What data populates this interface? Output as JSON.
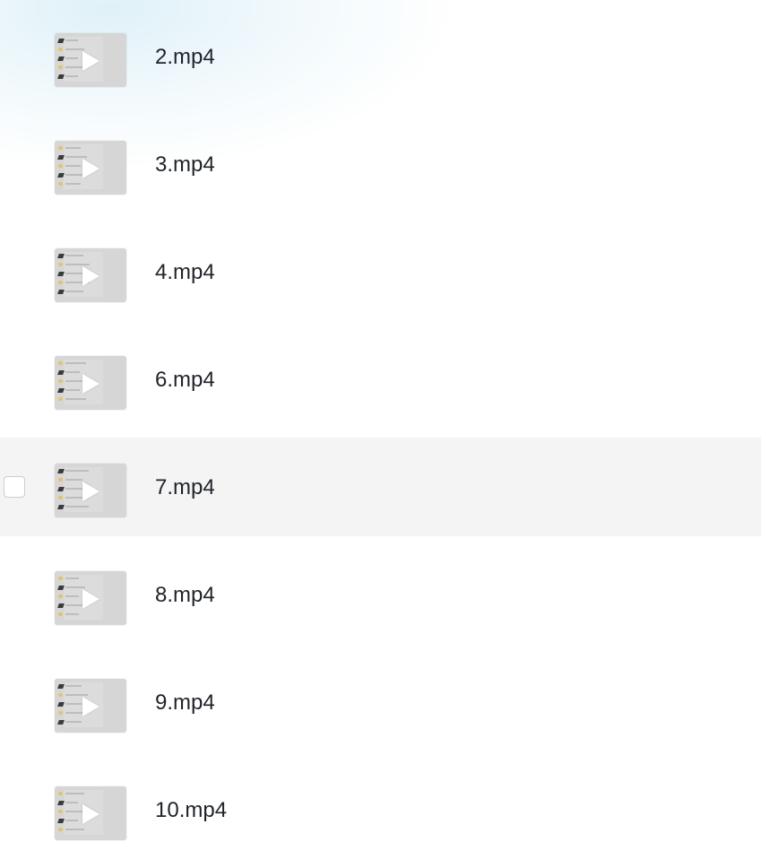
{
  "files": [
    {
      "name": "2.mp4",
      "thumbnail_icon": "video-thumbnail",
      "hovered": false
    },
    {
      "name": "3.mp4",
      "thumbnail_icon": "video-thumbnail",
      "hovered": false
    },
    {
      "name": "4.mp4",
      "thumbnail_icon": "video-thumbnail",
      "hovered": false
    },
    {
      "name": "6.mp4",
      "thumbnail_icon": "video-thumbnail",
      "hovered": false
    },
    {
      "name": "7.mp4",
      "thumbnail_icon": "video-thumbnail",
      "hovered": true
    },
    {
      "name": "8.mp4",
      "thumbnail_icon": "video-thumbnail",
      "hovered": false
    },
    {
      "name": "9.mp4",
      "thumbnail_icon": "video-thumbnail",
      "hovered": false
    },
    {
      "name": "10.mp4",
      "thumbnail_icon": "video-thumbnail",
      "hovered": false
    }
  ],
  "colors": {
    "hover_row_bg": "#f4f4f4",
    "text": "#1f2329",
    "thumbnail_bg": "#d6d6d6",
    "play_icon": "#ffffff"
  }
}
